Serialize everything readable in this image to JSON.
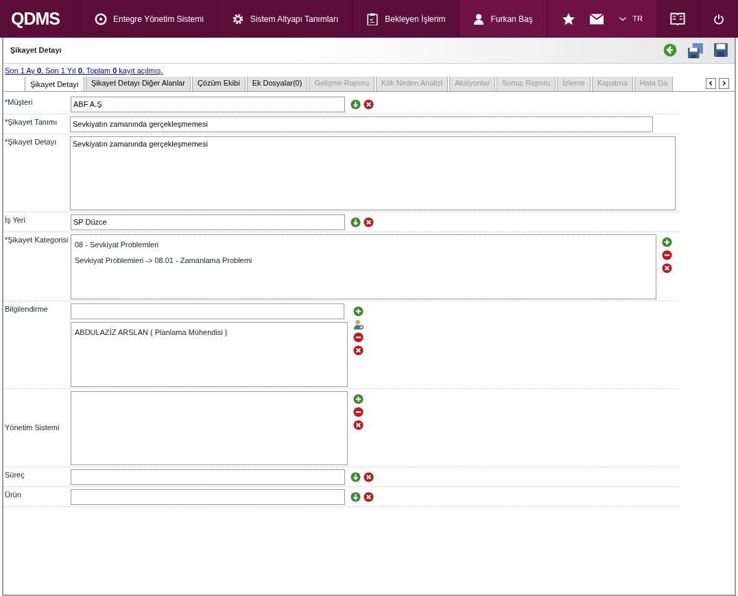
{
  "topbar": {
    "logo": "QDMS",
    "menu": [
      {
        "label": "Entegre Yönetim Sistemi"
      },
      {
        "label": "Sistem Altyapı Tanımları"
      },
      {
        "label": "Bekleyen İşlerim"
      }
    ],
    "user": "Furkan Baş",
    "language": "TR"
  },
  "page": {
    "title": "Şikayet Detayı",
    "summary": "Son 1 Ay **0**, Son 1 Yıl **0**, Toplam **0** kayıt açılmış."
  },
  "tabs": [
    {
      "label": "Şikayet Detayı",
      "selected": true,
      "disabled": false
    },
    {
      "label": "Şikayet Detayı Diğer Alanlar",
      "selected": false,
      "disabled": false
    },
    {
      "label": "Çözüm Ekibi",
      "selected": false,
      "disabled": false
    },
    {
      "label": "Ek Dosyalar(0)",
      "selected": false,
      "disabled": false
    },
    {
      "label": "Gelişme Raporu",
      "selected": false,
      "disabled": true
    },
    {
      "label": "Kök Neden Analizi",
      "selected": false,
      "disabled": true
    },
    {
      "label": "Aksiyonlar",
      "selected": false,
      "disabled": true
    },
    {
      "label": "Sonuç Raporu",
      "selected": false,
      "disabled": true
    },
    {
      "label": "İzleme",
      "selected": false,
      "disabled": true
    },
    {
      "label": "Kapatma",
      "selected": false,
      "disabled": true
    },
    {
      "label": "Hata Da",
      "selected": false,
      "disabled": true
    }
  ],
  "fields": [
    {
      "kind": "lookup",
      "label": "*Müşteri",
      "value": "ABF A.Ş"
    },
    {
      "kind": "text",
      "label": "*Şikayet Tanımı",
      "value": "Sevkiyatın zamanında gerçekleşmemesi"
    },
    {
      "kind": "textarea",
      "label": "*Şikayet Detayı",
      "value": "Sevkiyatın zamanında gerçekleşmemesi"
    },
    {
      "kind": "lookup",
      "label": "İş Yeri",
      "value": "SP Düzce"
    },
    {
      "kind": "list",
      "label": "*Şikayet Kategorisi",
      "items": [
        "08 - Sevkiyat Problemleri",
        "Sevkiyat Problemleri -> 08.01 - Zamanlama Problemi"
      ]
    },
    {
      "kind": "people",
      "label": "Bilgilendirme",
      "items": [
        "ABDULAZİZ ARSLAN ( Planlama Mühendisi )"
      ]
    },
    {
      "kind": "picklist",
      "label": "Yönetim Sistemi"
    },
    {
      "kind": "lookup",
      "label": "Süreç"
    },
    {
      "kind": "lookup",
      "label": "Ürün"
    }
  ]
}
